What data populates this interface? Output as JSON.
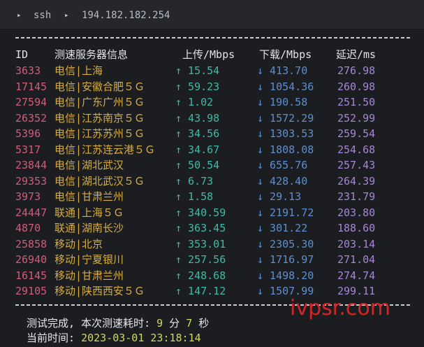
{
  "tabbar": {
    "segments": [
      {
        "arrow": "▸",
        "text": "ssh"
      },
      {
        "arrow": "▸",
        "text": "194.182.182.254"
      }
    ]
  },
  "table": {
    "headers": {
      "id": "ID",
      "isp": "测速服务器信息",
      "up": "上传/Mbps",
      "down": "下载/Mbps",
      "latency": "延迟/ms"
    },
    "rows": [
      {
        "id": "3633",
        "isp": "电信|上海",
        "up": "↑ 15.54",
        "down": "↓ 413.70",
        "latency": "276.98"
      },
      {
        "id": "17145",
        "isp": "电信|安徽合肥５Ｇ",
        "up": "↑ 59.23",
        "down": "↓ 1054.36",
        "latency": "260.98"
      },
      {
        "id": "27594",
        "isp": "电信|广东广州５Ｇ",
        "up": "↑ 1.02",
        "down": "↓ 190.58",
        "latency": "251.50"
      },
      {
        "id": "26352",
        "isp": "电信|江苏南京５Ｇ",
        "up": "↑ 43.98",
        "down": "↓ 1572.29",
        "latency": "252.99"
      },
      {
        "id": "5396",
        "isp": "电信|江苏苏州５Ｇ",
        "up": "↑ 34.56",
        "down": "↓ 1303.53",
        "latency": "259.54"
      },
      {
        "id": "5317",
        "isp": "电信|江苏连云港５Ｇ",
        "up": "↑ 34.67",
        "down": "↓ 1808.08",
        "latency": "254.68"
      },
      {
        "id": "23844",
        "isp": "电信|湖北武汉",
        "up": "↑ 50.54",
        "down": "↓ 655.76",
        "latency": "257.43"
      },
      {
        "id": "29353",
        "isp": "电信|湖北武汉５Ｇ",
        "up": "↑ 6.73",
        "down": "↓ 428.40",
        "latency": "264.39"
      },
      {
        "id": "3973",
        "isp": "电信|甘肃兰州",
        "up": "↑ 1.58",
        "down": "↓ 29.13",
        "latency": "231.79"
      },
      {
        "id": "24447",
        "isp": "联通|上海５Ｇ",
        "up": "↑ 340.59",
        "down": "↓ 2191.72",
        "latency": "203.80"
      },
      {
        "id": "4870",
        "isp": "联通|湖南长沙",
        "up": "↑ 363.45",
        "down": "↓ 301.22",
        "latency": "188.60"
      },
      {
        "id": "25858",
        "isp": "移动|北京",
        "up": "↑ 353.01",
        "down": "↓ 2305.30",
        "latency": "203.14"
      },
      {
        "id": "26940",
        "isp": "移动|宁夏银川",
        "up": "↑ 257.56",
        "down": "↓ 1716.97",
        "latency": "271.04"
      },
      {
        "id": "16145",
        "isp": "移动|甘肃兰州",
        "up": "↑ 248.68",
        "down": "↓ 1498.20",
        "latency": "274.74"
      },
      {
        "id": "29105",
        "isp": "移动|陕西西安５Ｇ",
        "up": "↑ 147.12",
        "down": "↓ 1507.99",
        "latency": "299.11"
      }
    ]
  },
  "footer": {
    "elapsed_prefix": "测试完成, 本次测速耗时: ",
    "minutes": "9",
    "minutes_unit": " 分 ",
    "seconds": "7",
    "seconds_unit": " 秒",
    "time_prefix": "当前时间: ",
    "time_value": "2023-03-01 23:18:14"
  },
  "watermark": "ivpsr.com",
  "colors": {
    "id": "#d05c7a",
    "isp": "#d6ad3e",
    "up": "#3fb9a8",
    "down": "#5d8fd0",
    "latency": "#a587d6",
    "highlight": "#d2d85e",
    "watermark": "#d62424"
  }
}
